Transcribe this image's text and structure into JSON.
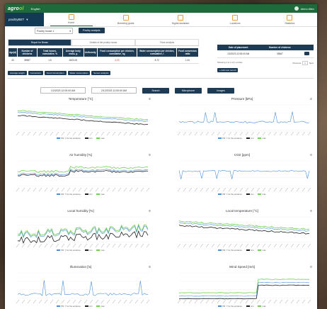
{
  "app": {
    "logo_a": "agro",
    "logo_b": "ol",
    "language": "English",
    "user": "demo.tiltex"
  },
  "nav": {
    "poultry": "poultryBET",
    "items": [
      {
        "label": "Home"
      },
      {
        "label": "Breeding guide"
      },
      {
        "label": "Digital assistant"
      },
      {
        "label": "Locations"
      },
      {
        "label": "Statistics"
      }
    ]
  },
  "controls": {
    "select_value": "Poultry house 1",
    "analysis_button": "Poultry analysis"
  },
  "tabs": [
    "Report for Bream",
    "Details of the poultry house",
    "Flock analysis"
  ],
  "summary": {
    "headers": [
      "Age(d)",
      "Number of chickens",
      "Total losses, cumulative, %",
      "Average body mass, g",
      "Uniformity",
      "Food consumption per chicken, cumulative, kg",
      "Water consumption per chicken, cumulative, l",
      "Food conversion ratio"
    ],
    "row": [
      "40",
      "35567",
      "1.5",
      "2623.25",
      "",
      "4.23",
      "8.72",
      "1.61"
    ]
  },
  "buttons": [
    "Average weight",
    "Conversion",
    "Food consumption",
    "Water consumption",
    "Sensor analysis"
  ],
  "placement": {
    "headers": [
      "Date of placement",
      "Number of chickens"
    ],
    "row": [
      "1/2/2023 12:00:00 AM",
      "35567"
    ],
    "info": "Showing 1 to 1 of 1 entries",
    "prev": "Previous",
    "page": "1",
    "next": "Next",
    "add": "Add new record"
  },
  "dates": {
    "from": "1/2/2023 12:00:00 AM",
    "to": "2/12/2023 12:00:00 AM",
    "search": "Search",
    "microphone": "Microphone",
    "images": "Images"
  },
  "legend": [
    "PR: Y for the entrance",
    "min",
    "max"
  ],
  "colors": {
    "series": "#4a90d9",
    "min": "#222222",
    "max": "#6fd14f"
  },
  "charts": [
    {
      "title": "Temperature [°C]"
    },
    {
      "title": "Pressure [kPa]"
    },
    {
      "title": "Air humidity [%]"
    },
    {
      "title": "CO2 [ppm]"
    },
    {
      "title": "Local humidity [%]"
    },
    {
      "title": "Local temperature [°C]"
    },
    {
      "title": "Illumination [lx]"
    },
    {
      "title": "Wind Speed [m/s]"
    }
  ]
}
